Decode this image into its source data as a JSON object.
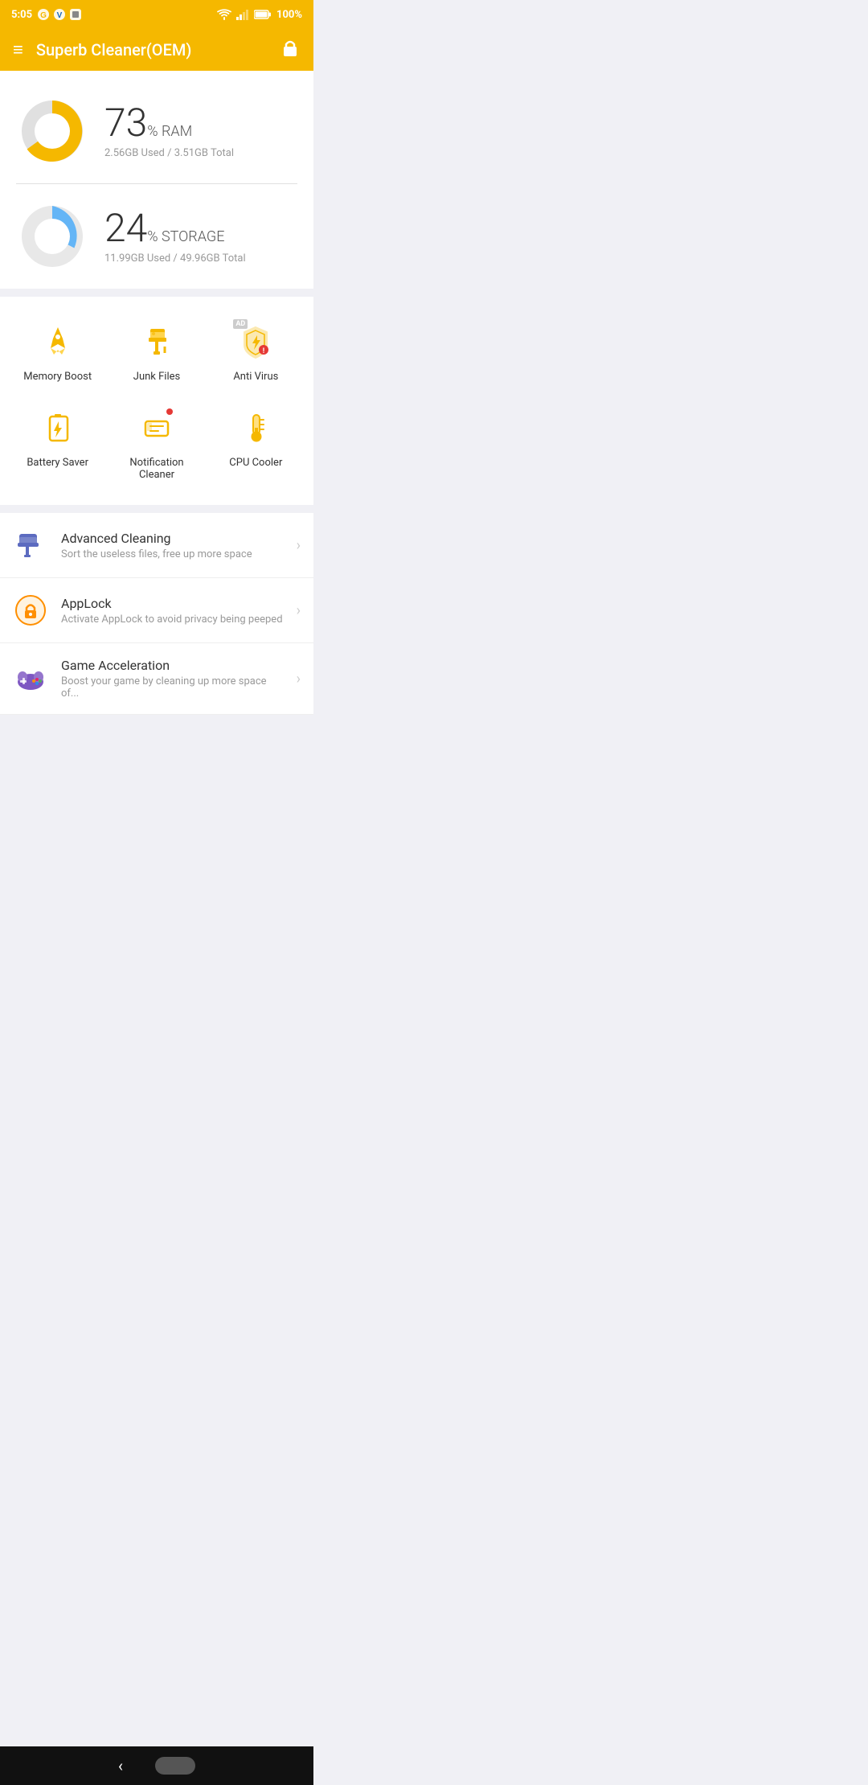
{
  "statusBar": {
    "time": "5:05",
    "battery": "100%"
  },
  "toolbar": {
    "title": "Superb Cleaner(OEM)",
    "menuIcon": "≡",
    "lockIcon": "🔒"
  },
  "ram": {
    "percentage": "73",
    "label": "% RAM",
    "detail": "2.56GB Used / 3.51GB Total",
    "color": "#F5B800",
    "usedFraction": 0.73
  },
  "storage": {
    "percentage": "24",
    "label": "% STORAGE",
    "detail": "11.99GB Used / 49.96GB Total",
    "color": "#64B5F6",
    "usedFraction": 0.24
  },
  "tools": [
    {
      "id": "memory-boost",
      "label": "Memory Boost",
      "iconType": "rocket",
      "ad": false,
      "dot": false
    },
    {
      "id": "junk-files",
      "label": "Junk Files",
      "iconType": "brush",
      "ad": false,
      "dot": false
    },
    {
      "id": "anti-virus",
      "label": "Anti Virus",
      "iconType": "shield",
      "ad": true,
      "dot": false
    },
    {
      "id": "battery-saver",
      "label": "Battery Saver",
      "iconType": "battery",
      "ad": false,
      "dot": false
    },
    {
      "id": "notification-cleaner",
      "label": "Notification Cleaner",
      "iconType": "notification",
      "ad": false,
      "dot": true
    },
    {
      "id": "cpu-cooler",
      "label": "CPU Cooler",
      "iconType": "thermometer",
      "ad": false,
      "dot": false
    }
  ],
  "listItems": [
    {
      "id": "advanced-cleaning",
      "title": "Advanced Cleaning",
      "subtitle": "Sort the useless files, free up more space",
      "iconType": "paintroller",
      "iconColor": "#5C6BC0"
    },
    {
      "id": "applock",
      "title": "AppLock",
      "subtitle": "Activate AppLock to avoid privacy being peeped",
      "iconType": "lock",
      "iconColor": "#FF8F00"
    },
    {
      "id": "game-acceleration",
      "title": "Game Acceleration",
      "subtitle": "Boost your game by cleaning up more space of...",
      "iconType": "game",
      "iconColor": "#7E57C2"
    }
  ],
  "bottomNav": {
    "backLabel": "‹"
  }
}
